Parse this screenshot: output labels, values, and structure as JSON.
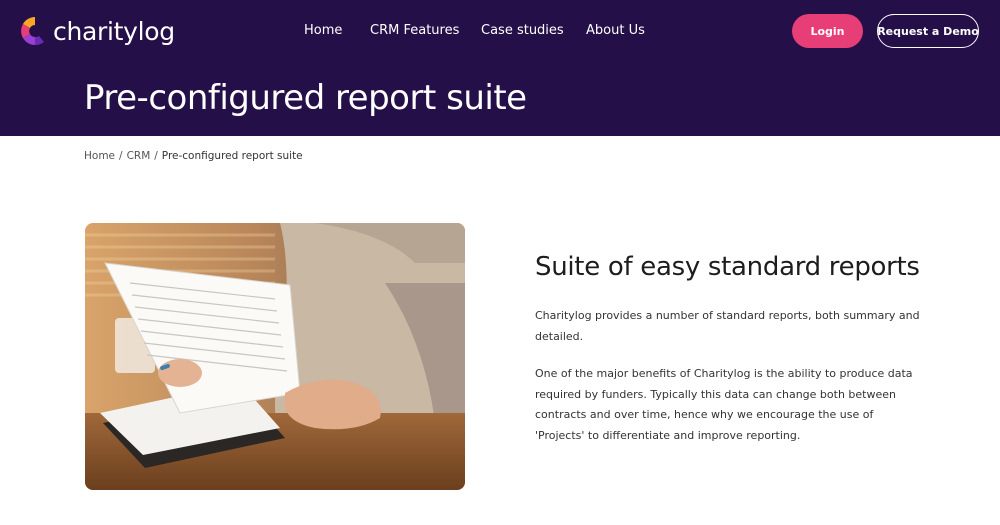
{
  "brand": {
    "name": "charitylog",
    "colors": {
      "header_bg": "#250f49",
      "login_bg": "#e83e77"
    }
  },
  "nav": {
    "items": [
      {
        "label": "Home"
      },
      {
        "label": "CRM Features"
      },
      {
        "label": "Case studies"
      },
      {
        "label": "About Us"
      }
    ],
    "login_label": "Login",
    "demo_label": "Request a Demo"
  },
  "hero": {
    "title": "Pre-configured report suite"
  },
  "breadcrumb": {
    "items": [
      "Home",
      "CRM",
      "Pre-configured report suite"
    ],
    "separator": "/"
  },
  "content": {
    "heading": "Suite of easy standard reports",
    "paragraphs": [
      "Charitylog provides a number of standard reports, both summary and detailed.",
      "One of the major benefits of Charitylog is the ability to produce data required by funders. Typically this data can change both between contracts and over time, hence why we encourage the use of 'Projects' to differentiate and improve reporting."
    ],
    "image_icon": "person-reading-documents-photo"
  }
}
